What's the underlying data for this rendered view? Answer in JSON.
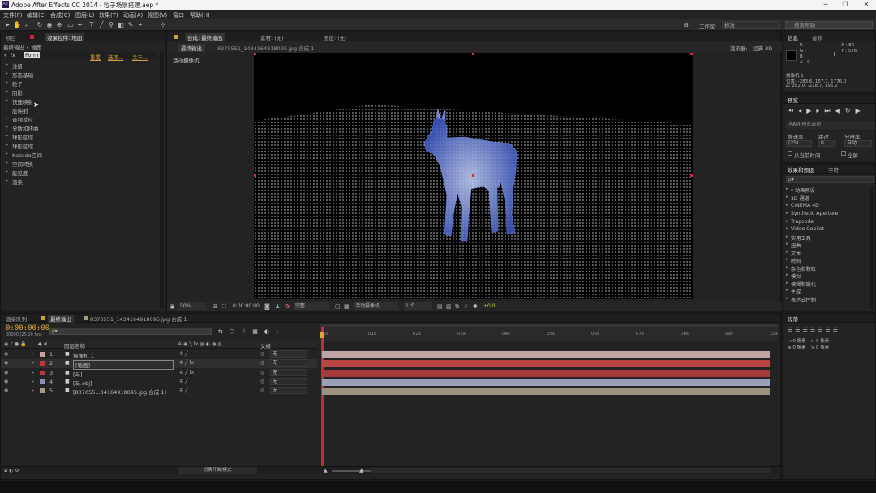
{
  "app": {
    "title": "Adobe After Effects CC 2014 - 粒子场景搭建.aep *"
  },
  "menu": [
    "文件(F)",
    "编辑(E)",
    "合成(C)",
    "图层(L)",
    "效果(T)",
    "动画(A)",
    "视图(V)",
    "窗口",
    "帮助(H)"
  ],
  "toolbar": {
    "workspace_label": "工作区:",
    "workspace_value": "标准",
    "search_placeholder": "搜索帮助"
  },
  "effects_panel": {
    "tabs": [
      "项目",
      "效果控件: 地面"
    ],
    "comp_label": "最终输出 • 地面",
    "effect_name": "Form",
    "links": [
      "重置",
      "选项...",
      "关于..."
    ],
    "properties": [
      "注册",
      "形态基础",
      "粒子",
      "阴影",
      "快速映射",
      "层映射",
      "音频反应",
      "分散和扭曲",
      "球形区域",
      "球形区域",
      "Kaleido空间",
      "空间转换",
      "能见度",
      "渲染"
    ]
  },
  "comp_panel": {
    "tabs": [
      "合成: 最终输出",
      "素材: (无)",
      "图层: (无)"
    ],
    "sub_tabs": [
      "最终输出",
      "8370551_1434164918095.jpg 合成 1"
    ],
    "renderer_label": "渲染器:",
    "renderer_value": "经典 3D",
    "camera_label": "活动摄像机",
    "footer": {
      "zoom": "50%",
      "timecode": "0:00:00:00",
      "quality": "完整",
      "view": "活动摄像机",
      "views": "1 个...",
      "exposure": "+0.0"
    }
  },
  "info_panel": {
    "tabs": [
      "信息",
      "音频"
    ],
    "rgba": [
      "R :",
      "G :",
      "B :",
      "A : 0"
    ],
    "xy": [
      "X : 80",
      "Y : 526"
    ],
    "layer": "摄像机 1",
    "position": "位置: -283.6, 157.7, 1776.0",
    "delta": "Δ: 282.0, -228.7, 196.2"
  },
  "preview_panel": {
    "tab": "预览",
    "ram_label": "RAM 预览选项",
    "frame_rate_label": "帧速率",
    "skip_label": "跳过",
    "resolution_label": "分辨率",
    "frame_rate": "(25)",
    "skip": "0",
    "resolution": "自动",
    "from_current": "从当前时间",
    "fullscreen": "全屏"
  },
  "effects_presets": {
    "tabs": [
      "效果和预设",
      "字符"
    ],
    "search_placeholder": "ρ▾",
    "items": [
      "* 动画预设",
      "3D 通道",
      "CINEMA 4D",
      "Synthetic Aperture",
      "Trapcode",
      "Video Copilot",
      "实用工具",
      "扭曲",
      "文本",
      "时间",
      "杂色和颗粒",
      "模拟",
      "模糊和锐化",
      "生成",
      "表达式控制"
    ]
  },
  "paragraph_panel": {
    "tab": "段落",
    "values": [
      "0 像素",
      "0 像素",
      "0 像素",
      "0 像素",
      "0 像素"
    ]
  },
  "timeline": {
    "tabs": [
      "渲染队列",
      "最终输出",
      "8370551_1434164918095.jpg 合成 1"
    ],
    "timecode": "0:00:00:00",
    "fps": "00000 (25.00 fps)",
    "search_placeholder": "ρ▾",
    "col_name": "图层名称",
    "col_parent": "父级",
    "ticks": [
      "0s",
      "01s",
      "02s",
      "03s",
      "04s",
      "05s",
      "06s",
      "07s",
      "08s",
      "09s",
      "10s"
    ],
    "toggle_label": "切换开关/模式",
    "layers": [
      {
        "num": "1",
        "name": "摄像机 1",
        "parent": "无",
        "color": "#c7a0a0",
        "bar": "#c2a2a2",
        "icon": "camera-icon",
        "selected": false
      },
      {
        "num": "2",
        "name": "[地面]",
        "parent": "无",
        "color": "#b33b3b",
        "bar": "#b94545",
        "icon": "solid-icon",
        "selected": true
      },
      {
        "num": "3",
        "name": "[马]",
        "parent": "无",
        "color": "#b33b3b",
        "bar": "#a63b3b",
        "icon": "solid-icon",
        "selected": false
      },
      {
        "num": "4",
        "name": "[马.obj]",
        "parent": "无",
        "color": "#8a8fb3",
        "bar": "#9aa0b8",
        "icon": "obj-file-icon",
        "selected": false
      },
      {
        "num": "5",
        "name": "[837055...3416491809­5.jpg 合成 1]",
        "parent": "无",
        "color": "#a69a80",
        "bar": "#9e927c",
        "icon": "comp-icon",
        "selected": false
      }
    ]
  }
}
